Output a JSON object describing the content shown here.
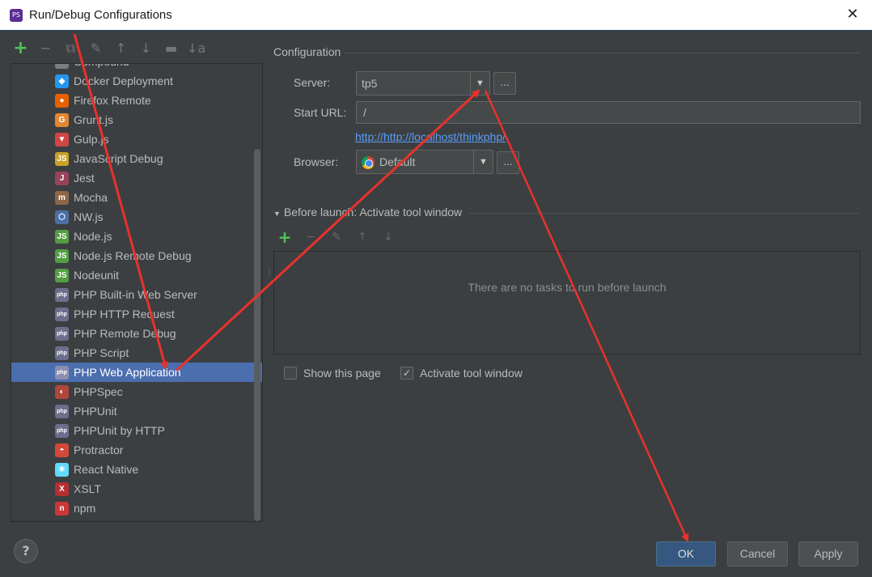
{
  "window": {
    "title": "Run/Debug Configurations",
    "icon": "phpstorm-icon"
  },
  "toolbar": {
    "add": "+",
    "remove": "−",
    "copy": "⧉",
    "wrench": "✎",
    "up": "↑",
    "down": "↓",
    "folder": "▬",
    "sort": "↓a"
  },
  "tree": {
    "items": [
      {
        "label": "Compound",
        "icon": "compound-icon",
        "color": "#7a7e80",
        "glyph": ""
      },
      {
        "label": "Docker Deployment",
        "icon": "docker-icon",
        "color": "#2496ed",
        "glyph": "◆"
      },
      {
        "label": "Firefox Remote",
        "icon": "firefox-icon",
        "color": "#e66000",
        "glyph": "●"
      },
      {
        "label": "Grunt.js",
        "icon": "grunt-icon",
        "color": "#e48632",
        "glyph": "G"
      },
      {
        "label": "Gulp.js",
        "icon": "gulp-icon",
        "color": "#cf4647",
        "glyph": "▼"
      },
      {
        "label": "JavaScript Debug",
        "icon": "javascript-debug-icon",
        "color": "#c9a227",
        "glyph": "JS"
      },
      {
        "label": "Jest",
        "icon": "jest-icon",
        "color": "#99425b",
        "glyph": "J"
      },
      {
        "label": "Mocha",
        "icon": "mocha-icon",
        "color": "#8d6748",
        "glyph": "m"
      },
      {
        "label": "NW.js",
        "icon": "nwjs-icon",
        "color": "#4a6fa5",
        "glyph": "⬡"
      },
      {
        "label": "Node.js",
        "icon": "nodejs-icon",
        "color": "#539e43",
        "glyph": "JS"
      },
      {
        "label": "Node.js Remote Debug",
        "icon": "nodejs-remote-icon",
        "color": "#539e43",
        "glyph": "JS"
      },
      {
        "label": "Nodeunit",
        "icon": "nodeunit-icon",
        "color": "#539e43",
        "glyph": "JS"
      },
      {
        "label": "PHP Built-in Web Server",
        "icon": "php-builtin-server-icon",
        "color": "#6b6f8c",
        "glyph": "php"
      },
      {
        "label": "PHP HTTP Request",
        "icon": "php-http-request-icon",
        "color": "#6b6f8c",
        "glyph": "php"
      },
      {
        "label": "PHP Remote Debug",
        "icon": "php-remote-debug-icon",
        "color": "#6b6f8c",
        "glyph": "php"
      },
      {
        "label": "PHP Script",
        "icon": "php-script-icon",
        "color": "#6b6f8c",
        "glyph": "php"
      },
      {
        "label": "PHP Web Application",
        "icon": "php-web-app-icon",
        "color": "#8b8fae",
        "glyph": "php"
      },
      {
        "label": "PHPSpec",
        "icon": "phpspec-icon",
        "color": "#b0463c",
        "glyph": "◐"
      },
      {
        "label": "PHPUnit",
        "icon": "phpunit-icon",
        "color": "#6b6f8c",
        "glyph": "php"
      },
      {
        "label": "PHPUnit by HTTP",
        "icon": "phpunit-http-icon",
        "color": "#6b6f8c",
        "glyph": "php"
      },
      {
        "label": "Protractor",
        "icon": "protractor-icon",
        "color": "#d24939",
        "glyph": "◓"
      },
      {
        "label": "React Native",
        "icon": "react-native-icon",
        "color": "#61dafb",
        "glyph": "⚛"
      },
      {
        "label": "XSLT",
        "icon": "xslt-icon",
        "color": "#b52e31",
        "glyph": "X"
      },
      {
        "label": "npm",
        "icon": "npm-icon",
        "color": "#cb3837",
        "glyph": "n"
      }
    ],
    "selected_index": 16
  },
  "config": {
    "section_title": "Configuration",
    "server_label": "Server:",
    "server_value": "tp5",
    "start_url_label": "Start URL:",
    "start_url_value": "/",
    "full_url": "http://http://localhost/thinkphp/",
    "browser_label": "Browser:",
    "browser_value": "Default",
    "more": "...",
    "arrow": "▼"
  },
  "before_launch": {
    "title": "Before launch: Activate tool window",
    "toggle": "▼",
    "empty_text": "There are no tasks to run before launch",
    "add": "+",
    "remove": "−",
    "edit": "✎",
    "up": "↑",
    "down": "↓"
  },
  "options": {
    "show_page_label": "Show this page",
    "show_page_checked": false,
    "activate_label": "Activate tool window",
    "activate_checked": true,
    "check_glyph": "✓"
  },
  "buttons": {
    "help": "?",
    "ok": "OK",
    "cancel": "Cancel",
    "apply": "Apply"
  },
  "colors": {
    "background": "#3c3f41",
    "selection": "#4b6eaf",
    "link": "#589df6",
    "annotation": "#e8322b"
  }
}
